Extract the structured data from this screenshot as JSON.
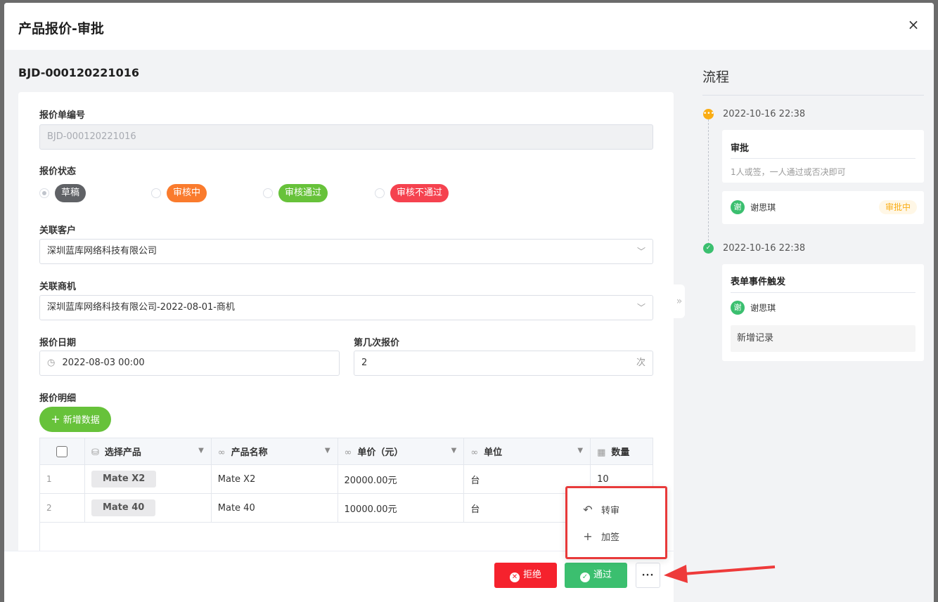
{
  "modal": {
    "title": "产品报价-审批",
    "close": "×"
  },
  "doc_no": "BJD-000120221016",
  "form": {
    "quote_no": {
      "label": "报价单编号",
      "value": "BJD-000120221016"
    },
    "status": {
      "label": "报价状态",
      "options": [
        {
          "label": "草稿",
          "color": "#606266",
          "checked": true
        },
        {
          "label": "审核中",
          "color": "#fa7b2d"
        },
        {
          "label": "审核通过",
          "color": "#67c23a"
        },
        {
          "label": "审核不通过",
          "color": "#f5424f"
        }
      ]
    },
    "customer": {
      "label": "关联客户",
      "value": "深圳蓝库网络科技有限公司"
    },
    "opportunity": {
      "label": "关联商机",
      "value": "深圳蓝库网络科技有限公司-2022-08-01-商机"
    },
    "quote_date": {
      "label": "报价日期",
      "value": "2022-08-03 00:00",
      "icon": "◷"
    },
    "quote_round": {
      "label": "第几次报价",
      "value": "2",
      "suffix": "次"
    },
    "details": {
      "label": "报价明细",
      "add_button": "新增数据",
      "columns": [
        "选择产品",
        "产品名称",
        "单价（元）",
        "单位",
        "数量"
      ],
      "rows": [
        {
          "index": "1",
          "product": "Mate X2",
          "name": "Mate X2",
          "price": "20000.00元",
          "unit": "台",
          "qty": "10"
        },
        {
          "index": "2",
          "product": "Mate 40",
          "name": "Mate 40",
          "price": "10000.00元",
          "unit": "台",
          "qty": ""
        }
      ]
    }
  },
  "footer": {
    "reject": "拒绝",
    "pass": "通过",
    "more": "···"
  },
  "popup": {
    "transfer": "转审",
    "add_sign": "加签"
  },
  "flow": {
    "title": "流程",
    "nodes": [
      {
        "time": "2022-10-16 22:38",
        "title": "审批",
        "desc": "1人或签，一人通过或否决即可",
        "user": "谢思琪",
        "avatar": "谢",
        "status": "审批中"
      },
      {
        "time": "2022-10-16 22:38",
        "title": "表单事件触发",
        "user": "谢思琪",
        "avatar": "谢",
        "record": "新增记录"
      }
    ]
  },
  "colors": {
    "accent_green": "#3bbf6f",
    "reject_red": "#f5222d",
    "warning": "#faad14",
    "highlight_red": "#e83a3a"
  }
}
